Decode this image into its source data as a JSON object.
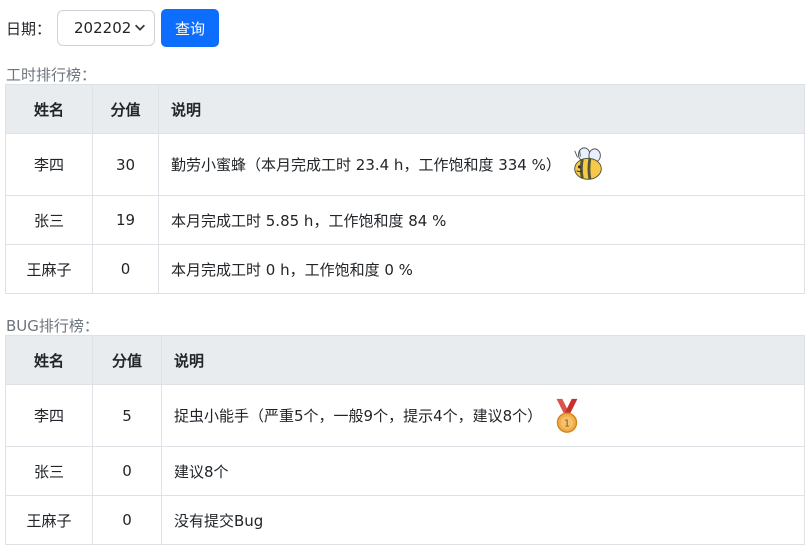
{
  "filter": {
    "date_label": "日期：",
    "date_value": "202202",
    "query_label": "查询"
  },
  "hours_ranking": {
    "title": "工时排行榜：",
    "headers": [
      "姓名",
      "分值",
      "说明"
    ],
    "rows": [
      {
        "name": "李四",
        "score": "30",
        "desc": "勤劳小蜜蜂（本月完成工时 23.4 h，工作饱和度 334 %）",
        "badge": "bee-icon"
      },
      {
        "name": "张三",
        "score": "19",
        "desc": "本月完成工时 5.85 h，工作饱和度 84 %"
      },
      {
        "name": "王麻子",
        "score": "0",
        "desc": "本月完成工时 0 h，工作饱和度 0 %"
      }
    ]
  },
  "bug_ranking": {
    "title": "BUG排行榜：",
    "headers": [
      "姓名",
      "分值",
      "说明"
    ],
    "rows": [
      {
        "name": "李四",
        "score": "5",
        "desc": "捉虫小能手（严重5个，一般9个，提示4个，建议8个）",
        "badge": "medal-icon"
      },
      {
        "name": "张三",
        "score": "0",
        "desc": "建议8个"
      },
      {
        "name": "王麻子",
        "score": "0",
        "desc": "没有提交Bug"
      }
    ]
  },
  "colors": {
    "primary": "#0d6efd",
    "header_bg": "#e9ecef",
    "border": "#dee2e6",
    "muted": "#6c757d"
  }
}
